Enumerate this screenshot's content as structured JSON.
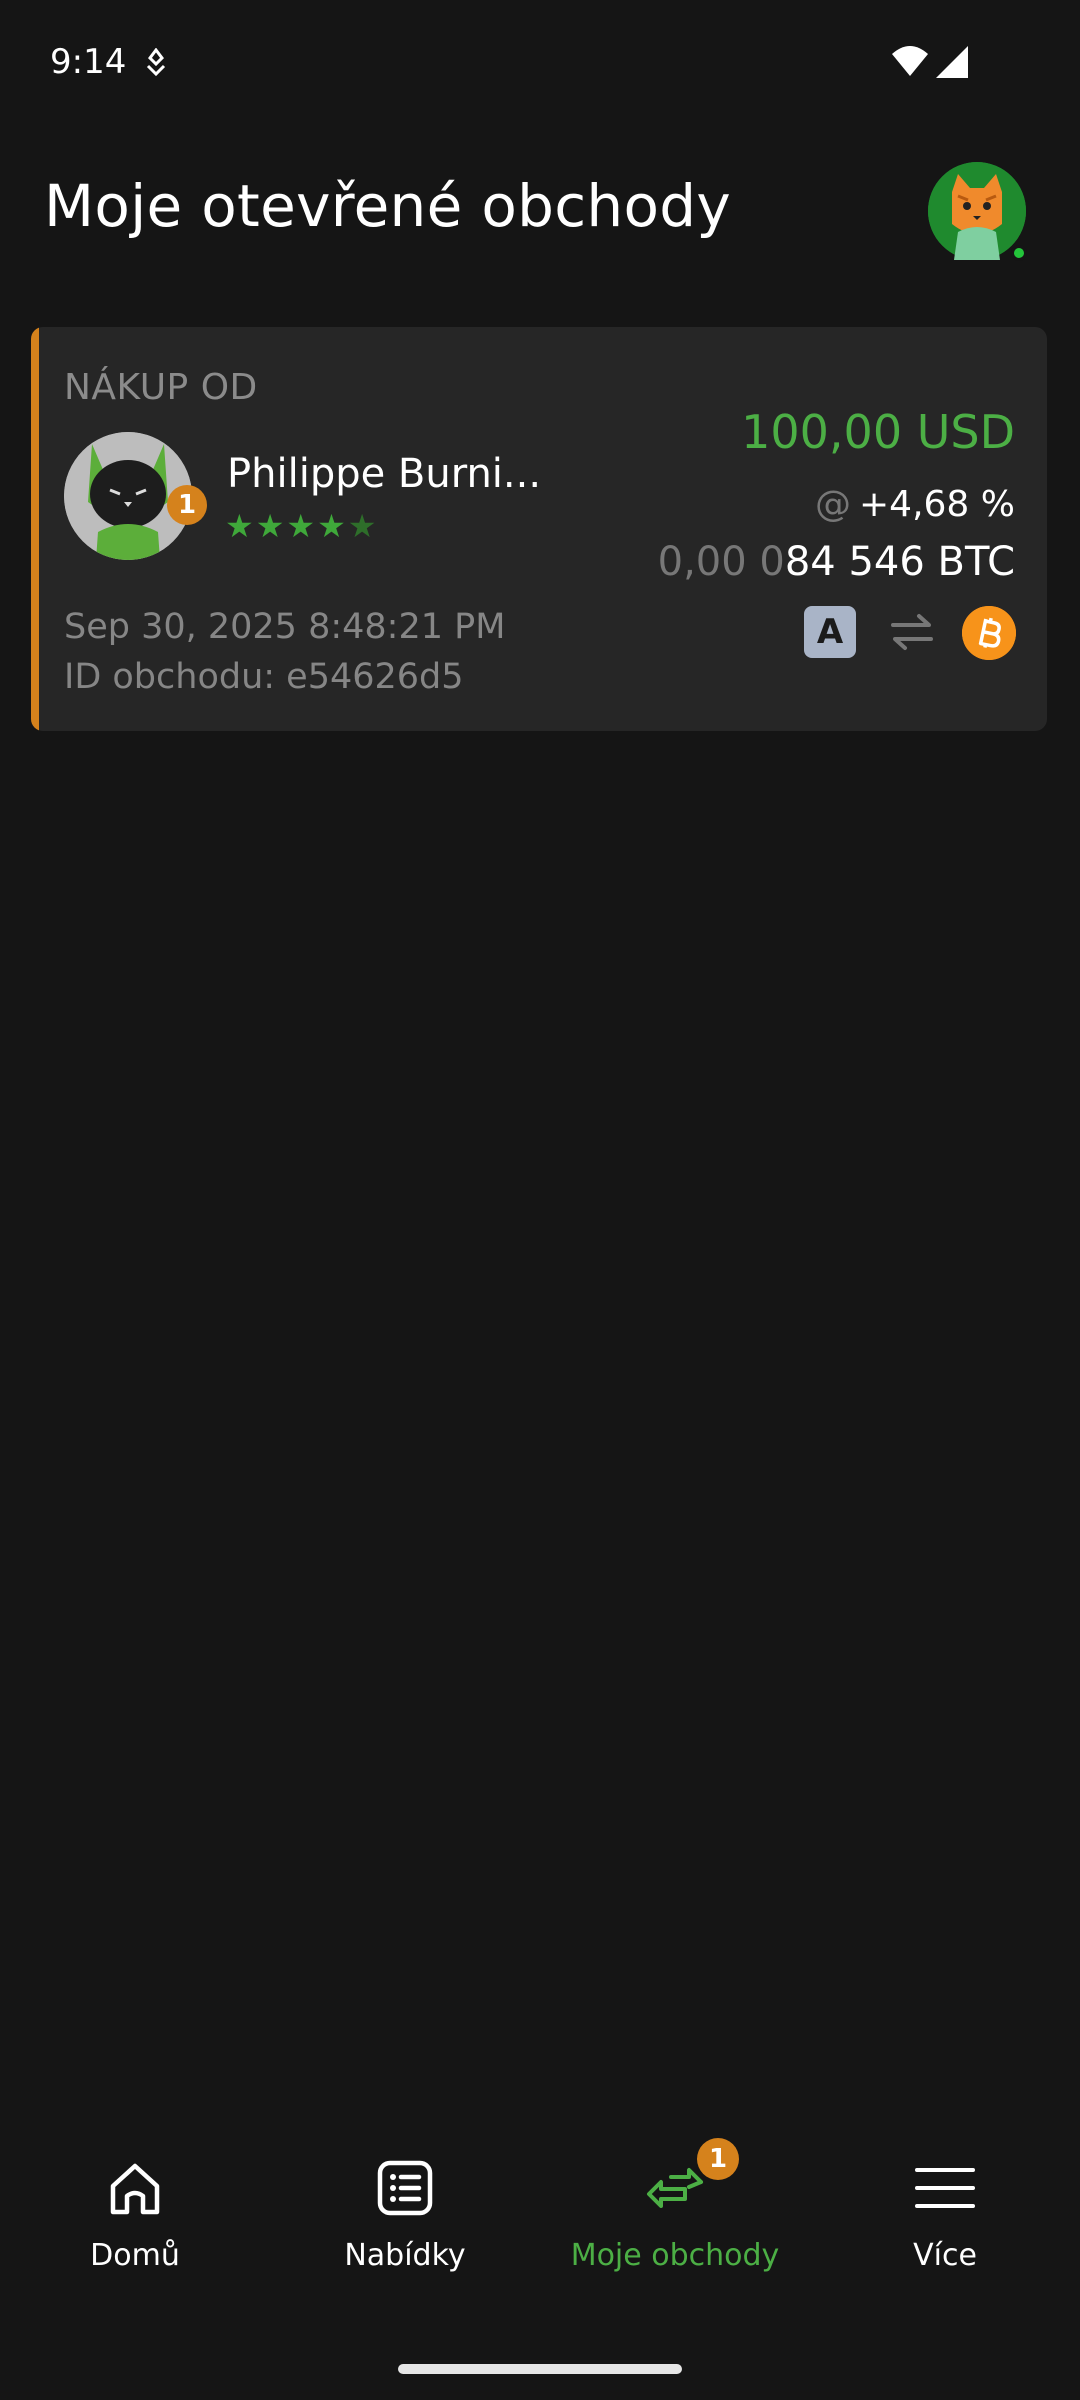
{
  "status_bar": {
    "time": "9:14"
  },
  "header": {
    "title": "Moje otevřené obchody"
  },
  "trade": {
    "direction": "NÁKUP OD",
    "peer": {
      "name": "Philippe Burni...",
      "badge": "1",
      "stars": "★★★★",
      "dim_star": "★",
      "rating": 4.5
    },
    "amount": "100,00 USD",
    "premium_at": "@",
    "premium": "+4,68 %",
    "btc_dim": "0,00 0",
    "btc_value": "84 546 BTC",
    "date": "Sep 30, 2025 8:48:21 PM",
    "trade_id": "ID obchodu: e54626d5",
    "payment_method_letter": "A"
  },
  "nav": {
    "items": [
      {
        "label": "Domů",
        "icon": "home-icon"
      },
      {
        "label": "Nabídky",
        "icon": "list-icon"
      },
      {
        "label": "Moje obchody",
        "icon": "swap-arrows-icon",
        "badge": "1",
        "active": true
      },
      {
        "label": "Více",
        "icon": "menu-icon"
      }
    ]
  },
  "colors": {
    "accent_green": "#4caf45",
    "accent_orange": "#d5821c",
    "background": "#151515",
    "card": "#262626"
  }
}
